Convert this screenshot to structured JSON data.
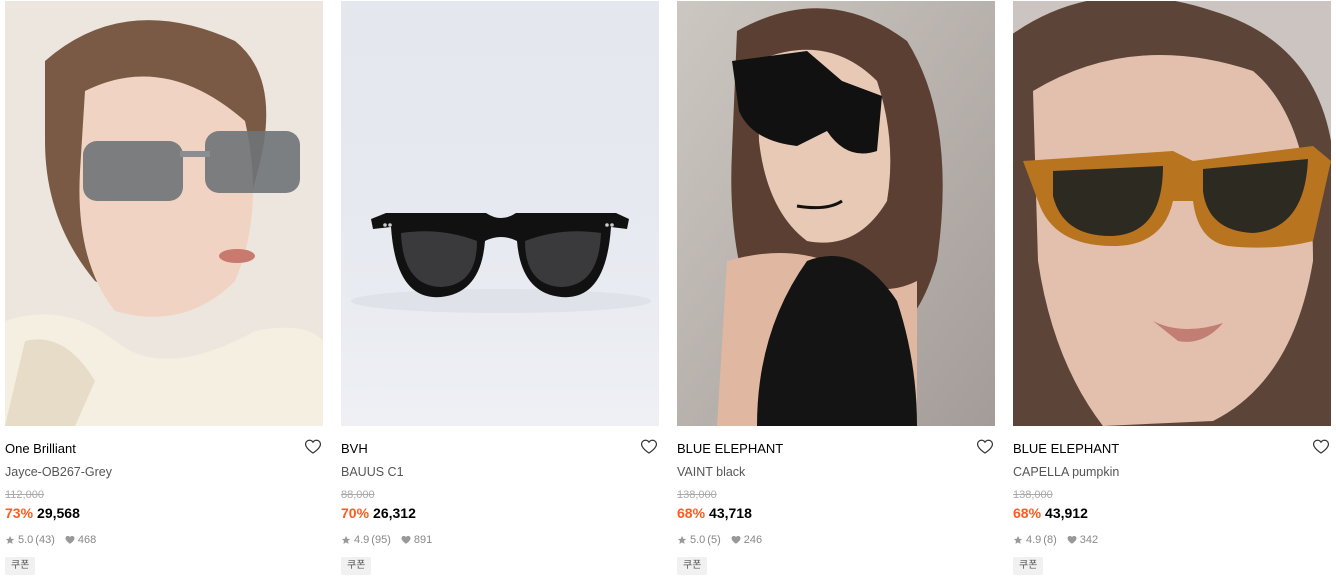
{
  "products": [
    {
      "brand": "One Brilliant",
      "name": "Jayce-OB267-Grey",
      "original_price": "112,000",
      "discount": "73%",
      "price": "29,568",
      "rating": "5.0",
      "review_count": "(43)",
      "likes": "468",
      "coupon_label": "쿠폰",
      "image": "model wearing grey square sunglasses"
    },
    {
      "brand": "BVH",
      "name": "BAUUS C1",
      "original_price": "88,000",
      "discount": "70%",
      "price": "26,312",
      "rating": "4.9",
      "review_count": "(95)",
      "likes": "891",
      "coupon_label": "쿠폰",
      "image": "black round sunglasses product shot"
    },
    {
      "brand": "BLUE ELEPHANT",
      "name": "VAINT black",
      "original_price": "138,000",
      "discount": "68%",
      "price": "43,718",
      "rating": "5.0",
      "review_count": "(5)",
      "likes": "246",
      "coupon_label": "쿠폰",
      "image": "model wearing black sunglasses"
    },
    {
      "brand": "BLUE ELEPHANT",
      "name": "CAPELLA pumpkin",
      "original_price": "138,000",
      "discount": "68%",
      "price": "43,912",
      "rating": "4.9",
      "review_count": "(8)",
      "likes": "342",
      "coupon_label": "쿠폰",
      "image": "model wearing amber square sunglasses"
    }
  ],
  "colors": {
    "discount": "#ff5a1f",
    "muted_text": "#888888",
    "strike_text": "#aaaaaa",
    "coupon_bg": "#f1f1f1"
  },
  "icons": {
    "wishlist": "heart-outline-icon",
    "rating": "star-icon",
    "likes": "heart-filled-icon"
  }
}
